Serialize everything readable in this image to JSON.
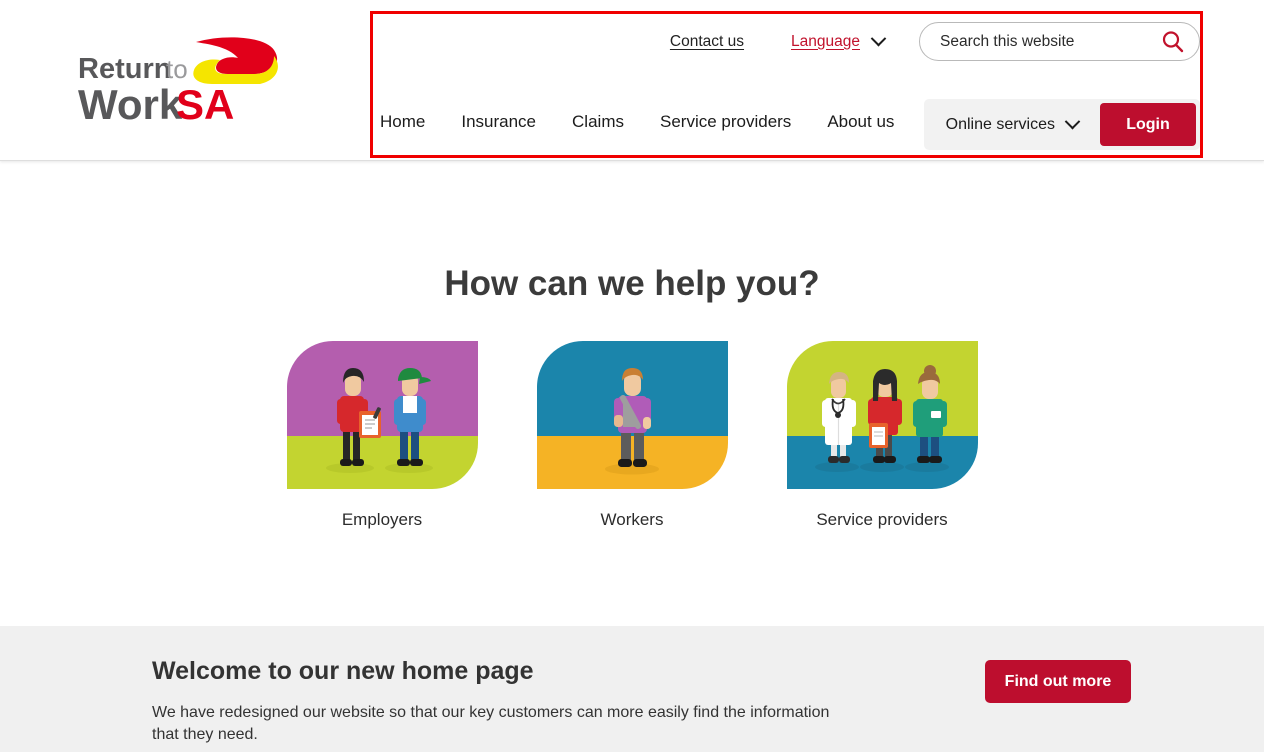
{
  "brand": {
    "name": "ReturnToWorkSA",
    "logo_line1_a": "Return",
    "logo_line1_b": "to",
    "logo_line2_a": "Work",
    "logo_line2_b": "SA",
    "red": "#e1001a",
    "yellow": "#f5e500",
    "dark_gray": "#58585a",
    "light_gray": "#9a9a9c"
  },
  "header": {
    "utility": {
      "contact_label": "Contact us",
      "language_label": "Language",
      "language_chevron_icon": "chevron-down-icon"
    },
    "search": {
      "placeholder": "Search this website",
      "value": "",
      "icon": "search-icon",
      "icon_color": "#c1122c"
    },
    "nav": [
      {
        "label": "Home"
      },
      {
        "label": "Insurance"
      },
      {
        "label": "Claims"
      },
      {
        "label": "Service providers"
      },
      {
        "label": "About us"
      }
    ],
    "account": {
      "online_services_label": "Online services",
      "online_services_chevron_icon": "chevron-down-icon",
      "login_label": "Login",
      "login_color": "#bd0e2e",
      "panel_color": "#f2f2f2"
    },
    "annotation": {
      "color": "#f00000",
      "shape": "rectangle"
    }
  },
  "help": {
    "title": "How can we help you?",
    "cards": [
      {
        "label": "Employers",
        "art_name": "employers-illustration",
        "top_color": "#b45eae",
        "bottom_color": "#c3d430"
      },
      {
        "label": "Workers",
        "art_name": "workers-illustration",
        "top_color": "#1b85ab",
        "bottom_color": "#f5b325"
      },
      {
        "label": "Service providers",
        "art_name": "service-providers-illustration",
        "top_color": "#c3d430",
        "bottom_color": "#1b85ab"
      }
    ]
  },
  "welcome": {
    "heading": "Welcome to our new home page",
    "body": "We have redesigned our website so that our key customers can more easily find the information that they need.",
    "cta_label": "Find out more",
    "band_color": "#f0f0f0"
  }
}
